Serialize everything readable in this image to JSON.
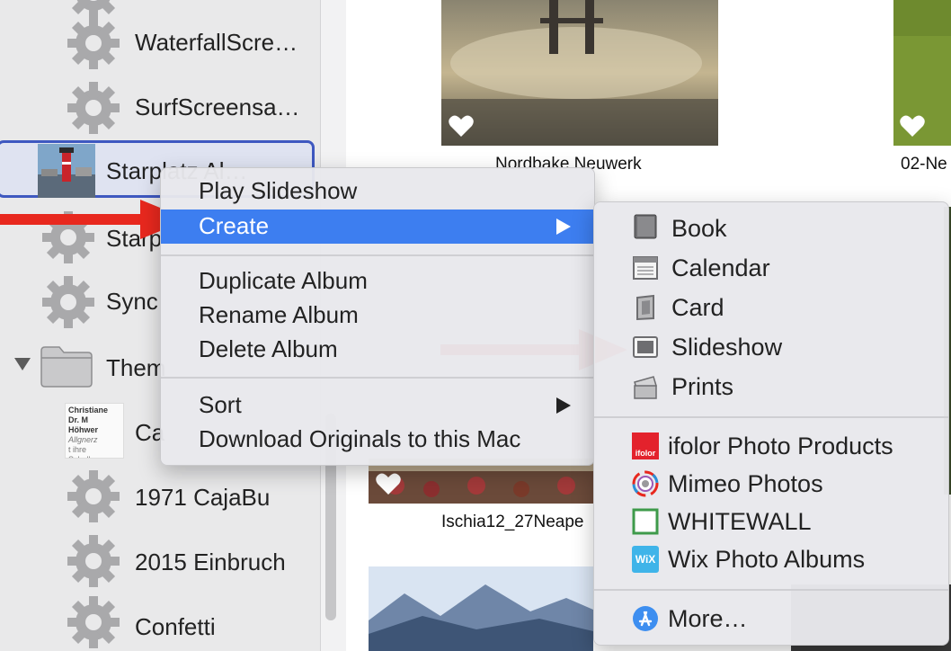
{
  "sidebar": {
    "items": [
      {
        "label": "WaterfallScre…"
      },
      {
        "label": "SurfScreensa…"
      },
      {
        "label": "Starplatz Al…"
      },
      {
        "label": "Starp"
      },
      {
        "label": "Sync"
      },
      {
        "label": "Them"
      },
      {
        "label": "Ca"
      },
      {
        "label": "1971 CajaBu"
      },
      {
        "label": "2015 Einbruch"
      },
      {
        "label": "Confetti"
      }
    ],
    "doc_thumb_lines": [
      "Christiane Dr. M",
      "Höhwer",
      "Allgnerz",
      "t ihre Schulkame"
    ]
  },
  "photos": {
    "captions": [
      "Nordbake Neuwerk",
      "02-Ne",
      "Ischia12_27Neape"
    ]
  },
  "context_menu": {
    "items": [
      "Play Slideshow",
      "Create",
      "Duplicate Album",
      "Rename Album",
      "Delete Album",
      "Sort",
      "Download Originals to this Mac"
    ],
    "highlighted": "Create"
  },
  "submenu": {
    "items": [
      {
        "label": "Book",
        "icon": "book-icon"
      },
      {
        "label": "Calendar",
        "icon": "calendar-icon"
      },
      {
        "label": "Card",
        "icon": "card-icon"
      },
      {
        "label": "Slideshow",
        "icon": "slideshow-icon"
      },
      {
        "label": "Prints",
        "icon": "prints-icon"
      }
    ],
    "extensions": [
      {
        "label": "ifolor Photo Products",
        "icon": "ifolor-icon",
        "icon_text": "ifolor"
      },
      {
        "label": "Mimeo Photos",
        "icon": "mimeo-icon"
      },
      {
        "label": "WHITEWALL",
        "icon": "whitewall-icon"
      },
      {
        "label": "Wix Photo Albums",
        "icon": "wix-icon",
        "icon_text": "WiX"
      }
    ],
    "more": {
      "label": "More…",
      "icon": "app-store-icon"
    }
  },
  "colors": {
    "highlight": "#3d7ef0",
    "arrow": "#e8281e",
    "selection_border": "#3e58c0"
  }
}
